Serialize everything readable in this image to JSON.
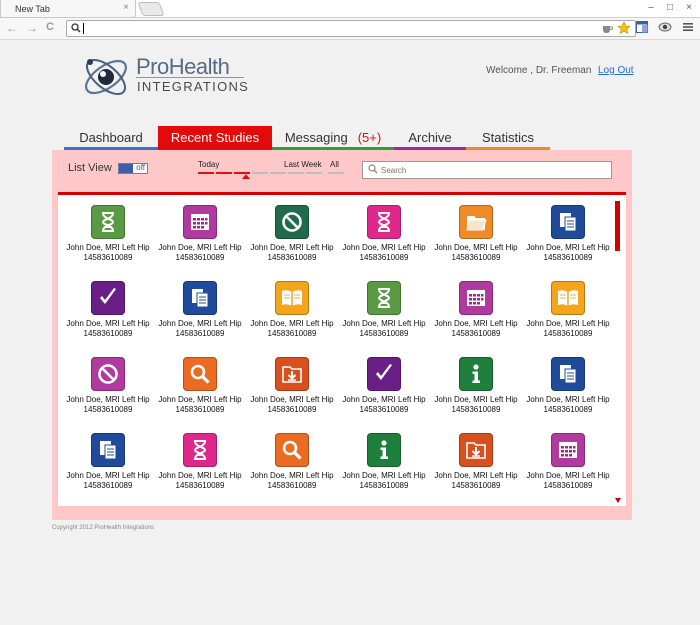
{
  "browser": {
    "tab_title": "New Tab",
    "tab_close": "×",
    "address_value": "",
    "window_buttons": [
      "–",
      "□",
      "×"
    ],
    "back": "←",
    "forward": "→",
    "reload": "C"
  },
  "header": {
    "logo_pro": "ProHealth",
    "logo_integrations": "INTEGRATIONS",
    "welcome": "Welcome , Dr. Freeman",
    "logout": "Log Out"
  },
  "nav": {
    "tabs": [
      {
        "label": "Dashboard",
        "color": "#3b6fd0"
      },
      {
        "label": "Recent Studies",
        "color": "#e20b0b"
      },
      {
        "label": "Messaging",
        "badge": "(5+)",
        "color": "#2e9f3e"
      },
      {
        "label": "Archive",
        "color": "#9b2a9b"
      },
      {
        "label": "Statistics",
        "color": "#ee8a2a"
      }
    ]
  },
  "controls": {
    "list_view": "List View",
    "toggle_text": "off",
    "range_today": "Today",
    "range_last_week": "Last Week",
    "range_all": "All",
    "search_placeholder": "Search"
  },
  "studies": [
    {
      "name": "John Doe, MRI Left Hip",
      "id": "14583610089",
      "icon": "hourglass-icon",
      "color": "#5a9a44"
    },
    {
      "name": "John Doe, MRI Left Hip",
      "id": "14583610089",
      "icon": "calendar-icon",
      "color": "#b03a9e"
    },
    {
      "name": "John Doe, MRI Left Hip",
      "id": "14583610089",
      "icon": "prohibited-icon",
      "color": "#1f6b4c"
    },
    {
      "name": "John Doe, MRI Left Hip",
      "id": "14583610089",
      "icon": "hourglass-icon",
      "color": "#e0288c"
    },
    {
      "name": "John Doe, MRI Left Hip",
      "id": "14583610089",
      "icon": "folder-icon",
      "color": "#ef8b27"
    },
    {
      "name": "John Doe, MRI Left Hip",
      "id": "14583610089",
      "icon": "documents-icon",
      "color": "#1f4b9a"
    },
    {
      "name": "John Doe, MRI Left Hip",
      "id": "14583610089",
      "icon": "checkmark-icon",
      "color": "#6a1f86"
    },
    {
      "name": "John Doe, MRI Left Hip",
      "id": "14583610089",
      "icon": "documents-icon",
      "color": "#1f4b9a"
    },
    {
      "name": "John Doe, MRI Left Hip",
      "id": "14583610089",
      "icon": "book-icon",
      "color": "#f4a51c"
    },
    {
      "name": "John Doe, MRI Left Hip",
      "id": "14583610089",
      "icon": "hourglass-icon",
      "color": "#5a9a44"
    },
    {
      "name": "John Doe, MRI Left Hip",
      "id": "14583610089",
      "icon": "calendar-icon",
      "color": "#b03a9e"
    },
    {
      "name": "John Doe, MRI Left Hip",
      "id": "14583610089",
      "icon": "book-icon",
      "color": "#f4a51c"
    },
    {
      "name": "John Doe, MRI Left Hip",
      "id": "14583610089",
      "icon": "prohibited-icon",
      "color": "#b03a9e"
    },
    {
      "name": "John Doe, MRI Left Hip",
      "id": "14583610089",
      "icon": "magnifier-icon",
      "color": "#ec6b22"
    },
    {
      "name": "John Doe, MRI Left Hip",
      "id": "14583610089",
      "icon": "download-icon",
      "color": "#d9501f"
    },
    {
      "name": "John Doe, MRI Left Hip",
      "id": "14583610089",
      "icon": "checkmark-icon",
      "color": "#6a1f86"
    },
    {
      "name": "John Doe, MRI Left Hip",
      "id": "14583610089",
      "icon": "info-icon",
      "color": "#1e7f3c"
    },
    {
      "name": "John Doe, MRI Left Hip",
      "id": "14583610089",
      "icon": "documents-icon",
      "color": "#1f4b9a"
    },
    {
      "name": "John Doe, MRI Left Hip",
      "id": "14583610089",
      "icon": "documents-icon",
      "color": "#1f4b9a"
    },
    {
      "name": "John Doe, MRI Left Hip",
      "id": "14583610089",
      "icon": "hourglass-icon",
      "color": "#e0288c"
    },
    {
      "name": "John Doe, MRI Left Hip",
      "id": "14583610089",
      "icon": "magnifier-icon",
      "color": "#ec6b22"
    },
    {
      "name": "John Doe, MRI Left Hip",
      "id": "14583610089",
      "icon": "info-icon",
      "color": "#1e7f3c"
    },
    {
      "name": "John Doe, MRI Left Hip",
      "id": "14583610089",
      "icon": "download-icon",
      "color": "#d9501f"
    },
    {
      "name": "John Doe, MRI Left Hip",
      "id": "14583610089",
      "icon": "calendar-icon",
      "color": "#b03a9e"
    }
  ],
  "footer": {
    "copyright": "Copyright 2012 ProHealth Integrations"
  }
}
